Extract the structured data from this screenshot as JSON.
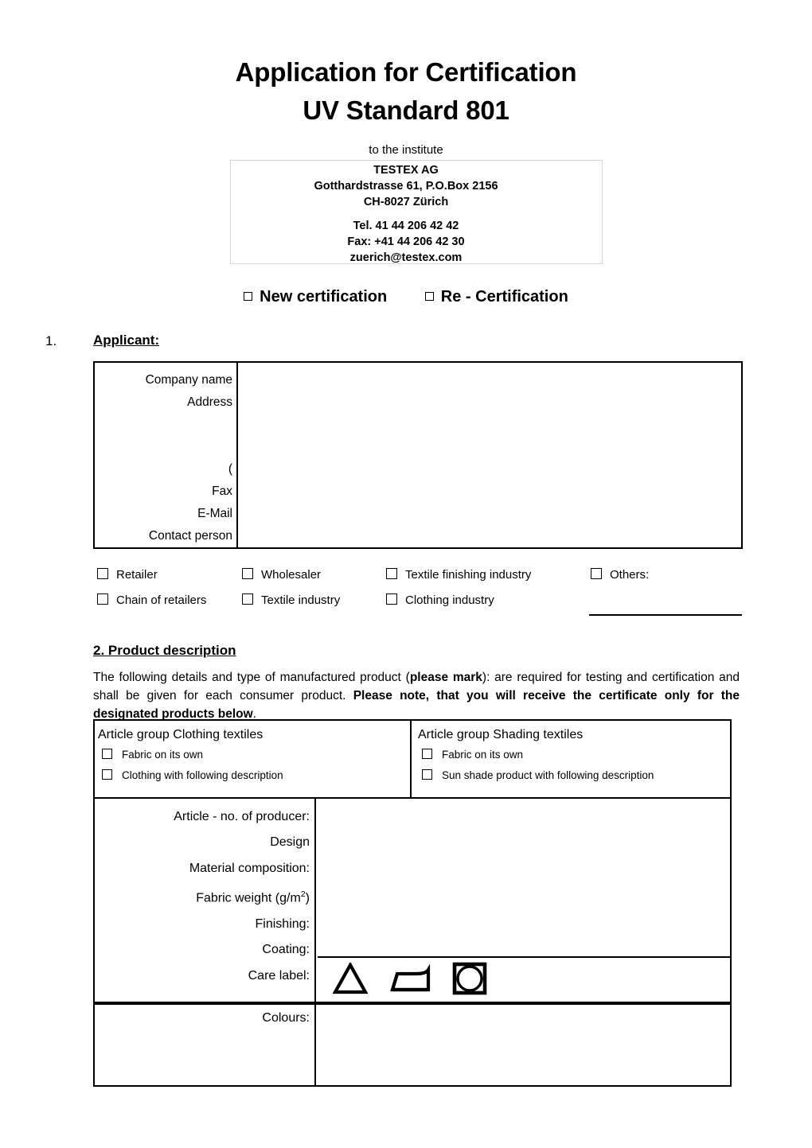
{
  "title": {
    "line1": "Application for Certification",
    "line2": "UV Standard 801"
  },
  "institute": {
    "intro": "to the institute",
    "name": "TESTEX AG",
    "street": "Gotthardstrasse 61, P.O.Box 2156",
    "city": "CH-8027 Zürich",
    "tel": "Tel.   41 44 206 42 42",
    "fax": "Fax: +41 44 206 42 30",
    "email": "zuerich@testex.com"
  },
  "certification_type": {
    "new_label": "New certification",
    "re_label": "Re - Certification"
  },
  "section1": {
    "number": "1.",
    "title": "Applicant:",
    "fields": [
      "Company name",
      "Address",
      "(",
      "Fax",
      "E-Mail",
      "Contact person"
    ],
    "company_types": {
      "row1": [
        "Retailer",
        "Wholesaler",
        "Textile finishing industry",
        "Others:"
      ],
      "row2": [
        "Chain of retailers",
        "Textile industry",
        "Clothing industry"
      ]
    }
  },
  "section2": {
    "title": "2. Product description",
    "paragraph": {
      "p1": "The following details and type of manufactured product (",
      "b1": "please mark",
      "p2": "): are required for testing and certification and shall be given for each consumer product. ",
      "b2": "Please note, that you will receive the certificate only for the designated products below",
      "p3": "."
    },
    "article_groups": [
      {
        "heading": "Article group Clothing textiles",
        "options": [
          "Fabric on its own",
          "Clothing with following description"
        ]
      },
      {
        "heading": "Article group Shading textiles",
        "options": [
          "Fabric on its own",
          "Sun shade product with following description"
        ]
      }
    ],
    "detail_labels": {
      "article_no": "Article - no. of producer:",
      "design": "Design",
      "material": "Material composition:",
      "fabric_weight_main": "Fabric weight (g/m",
      "fabric_weight_sup": "2",
      "fabric_weight_tail": ")",
      "finishing": "Finishing:",
      "coating": "Coating:",
      "care_label": "Care label:"
    },
    "care_symbols": [
      "bleaching-triangle-icon",
      "ironing-icon",
      "tumble-dry-icon"
    ],
    "colours_label": "Colours:"
  },
  "colors": {
    "ink": "#000000",
    "box_border": "#d6d6d6",
    "page_bg": "#ffffff"
  }
}
